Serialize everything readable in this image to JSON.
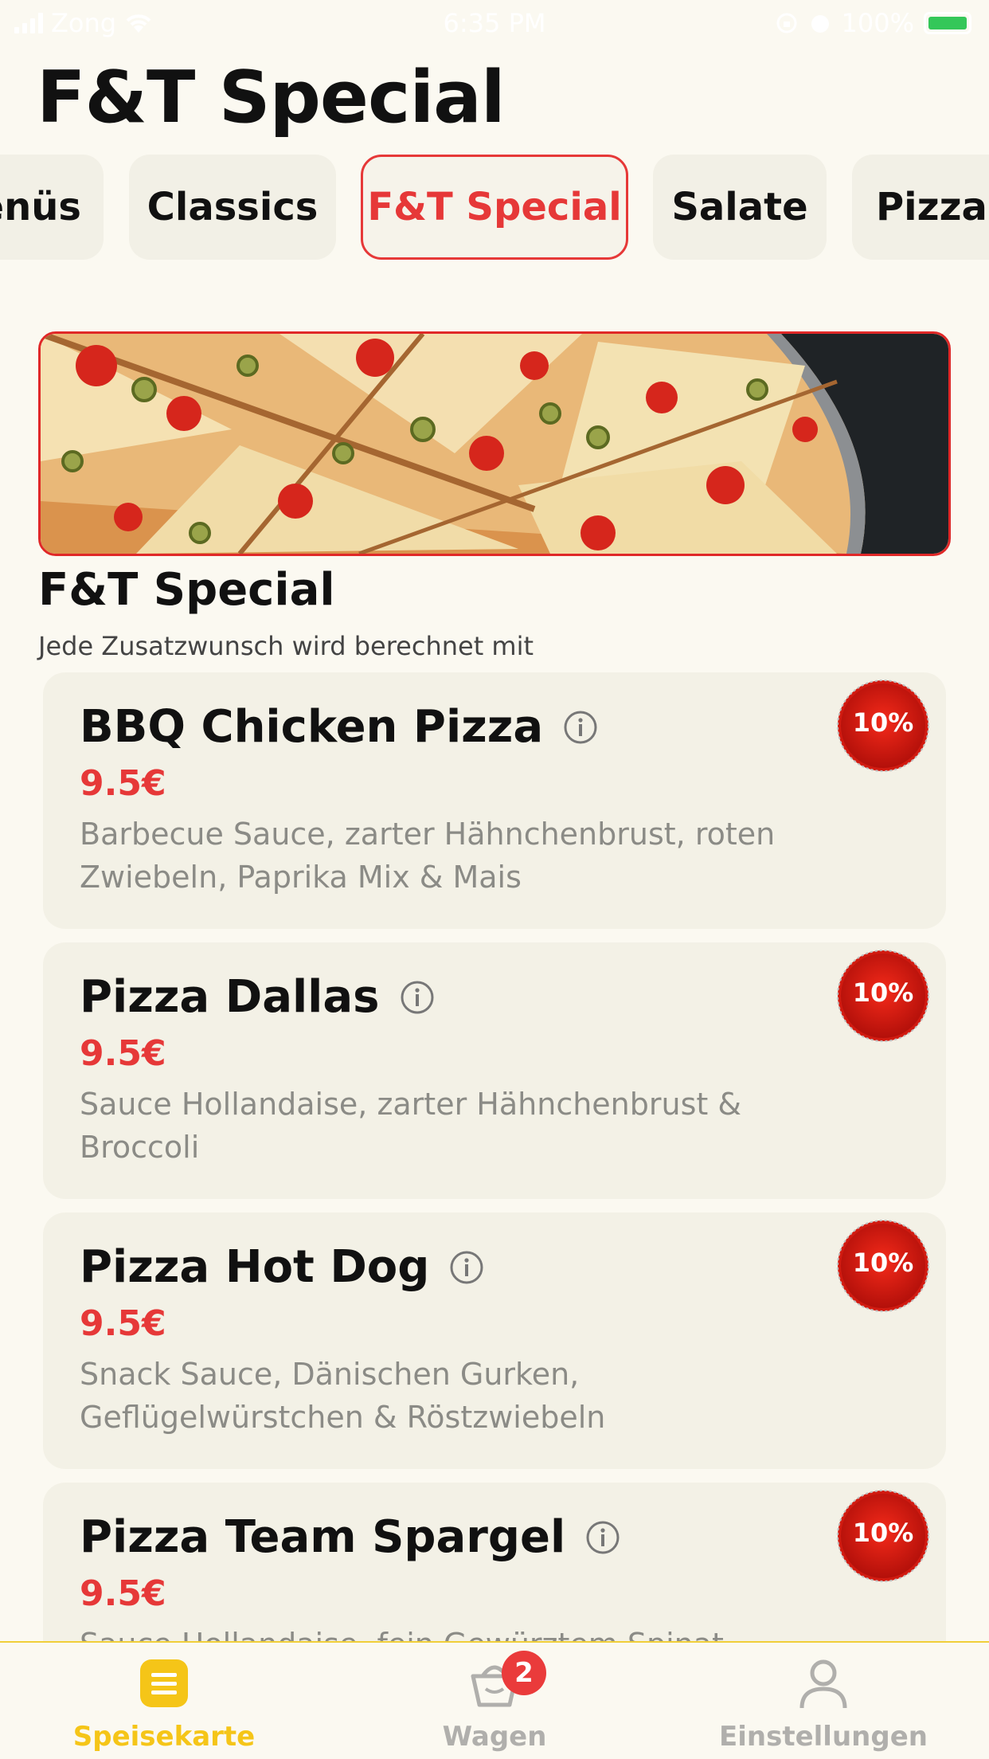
{
  "status_bar": {
    "carrier": "Zong",
    "time": "6:35 PM",
    "battery": "100%"
  },
  "page_title": "F&T Special",
  "tabs": [
    {
      "label": "enüs",
      "active": false
    },
    {
      "label": "Classics",
      "active": false
    },
    {
      "label": "F&T Special",
      "active": true
    },
    {
      "label": "Salate",
      "active": false
    },
    {
      "label": "Pizzab",
      "active": false
    }
  ],
  "section": {
    "title": "F&T Special",
    "note": "Jede Zusatzwunsch wird berechnet mit"
  },
  "products": [
    {
      "name": "BBQ Chicken Pizza",
      "price": "9.5€",
      "description": "Barbecue Sauce, zarter Hähnchenbrust, roten Zwiebeln, Paprika Mix & Mais",
      "badge": "10%"
    },
    {
      "name": "Pizza Dallas",
      "price": "9.5€",
      "description": "Sauce Hollandaise, zarter Hähnchenbrust & Broccoli",
      "badge": "10%"
    },
    {
      "name": "Pizza Hot Dog",
      "price": "9.5€",
      "description": "Snack Sauce, Dänischen Gurken, Geflügelwürstchen & Röstzwiebeln",
      "badge": "10%"
    },
    {
      "name": "Pizza Team Spargel",
      "price": "9.5€",
      "description": "Sauce Hollandaise, fein Gewürztem Spinat",
      "badge": "10%"
    }
  ],
  "bottom_nav": {
    "items": [
      {
        "label": "Speisekarte",
        "icon": "menu-icon",
        "active": true
      },
      {
        "label": "Wagen",
        "icon": "basket-icon",
        "active": false,
        "badge": "2"
      },
      {
        "label": "Einstellungen",
        "icon": "user-icon",
        "active": false
      }
    ]
  },
  "colors": {
    "accent_red": "#e63838",
    "accent_yellow": "#f5c518",
    "background": "#fbf9f1",
    "card": "#f3f1e6"
  }
}
